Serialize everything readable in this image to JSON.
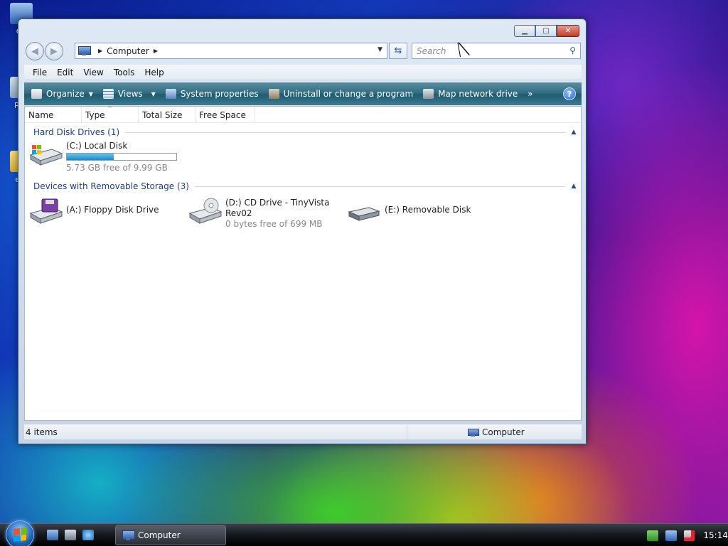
{
  "desktop": {
    "icons": [
      {
        "label": "Co"
      },
      {
        "label": "Rec"
      },
      {
        "label": "eXI"
      }
    ]
  },
  "window": {
    "caption_buttons": {
      "minimize": "▁",
      "maximize": "□",
      "close": "✕"
    },
    "address": {
      "crumb": "Computer"
    },
    "search": {
      "placeholder": "Search"
    },
    "menu": {
      "file": "File",
      "edit": "Edit",
      "view": "View",
      "tools": "Tools",
      "help": "Help"
    },
    "commands": {
      "organize": "Organize",
      "views": "Views",
      "system_properties": "System properties",
      "uninstall": "Uninstall or change a program",
      "map_network_drive": "Map network drive",
      "more": "»",
      "help": "?"
    },
    "columns": {
      "name": "Name",
      "type": "Type",
      "total_size": "Total Size",
      "free_space": "Free Space"
    },
    "groups": {
      "hard_disk": {
        "title": "Hard Disk Drives (1)",
        "drives": [
          {
            "name": "(C:) Local Disk",
            "detail": "5.73 GB free of 9.99 GB",
            "used_fraction": 0.43
          }
        ]
      },
      "removable": {
        "title": "Devices with Removable Storage (3)",
        "drives": [
          {
            "name": "(A:) Floppy Disk Drive"
          },
          {
            "name_line1": "(D:) CD Drive - TinyVista",
            "name_line2": "Rev02",
            "detail": "0 bytes free of 699 MB"
          },
          {
            "name": "(E:) Removable Disk"
          }
        ]
      }
    },
    "status": {
      "item_count": "4 items",
      "location": "Computer"
    }
  },
  "taskbar": {
    "task_label": "Computer",
    "clock": "15:14"
  },
  "colors": {
    "command_bar": "#2f6b80",
    "group_title": "#1e3d8c",
    "capacity_fill": "#1d8ac4"
  }
}
